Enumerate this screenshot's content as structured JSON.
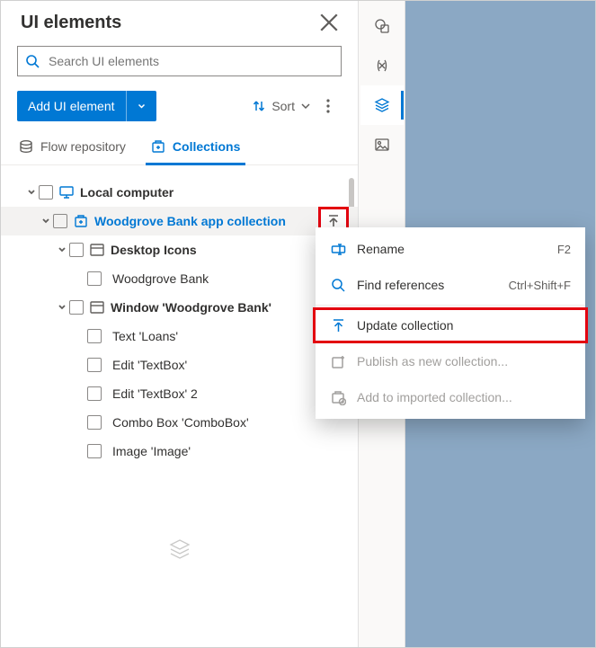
{
  "panel": {
    "title": "UI elements",
    "search_placeholder": "Search UI elements",
    "add_button": "Add UI element",
    "sort_label": "Sort"
  },
  "tabs": {
    "flow": "Flow repository",
    "collections": "Collections"
  },
  "tree": {
    "root": "Local computer",
    "collection": "Woodgrove Bank app collection",
    "group1": "Desktop Icons",
    "group1_items": [
      "Woodgrove Bank"
    ],
    "group2": "Window 'Woodgrove Bank'",
    "group2_items": [
      "Text 'Loans'",
      "Edit 'TextBox'",
      "Edit 'TextBox' 2",
      "Combo Box 'ComboBox'",
      "Image 'Image'"
    ]
  },
  "ctx": {
    "rename": "Rename",
    "rename_short": "F2",
    "find": "Find references",
    "find_short": "Ctrl+Shift+F",
    "update": "Update collection",
    "publish": "Publish as new collection...",
    "addto": "Add to imported collection..."
  }
}
